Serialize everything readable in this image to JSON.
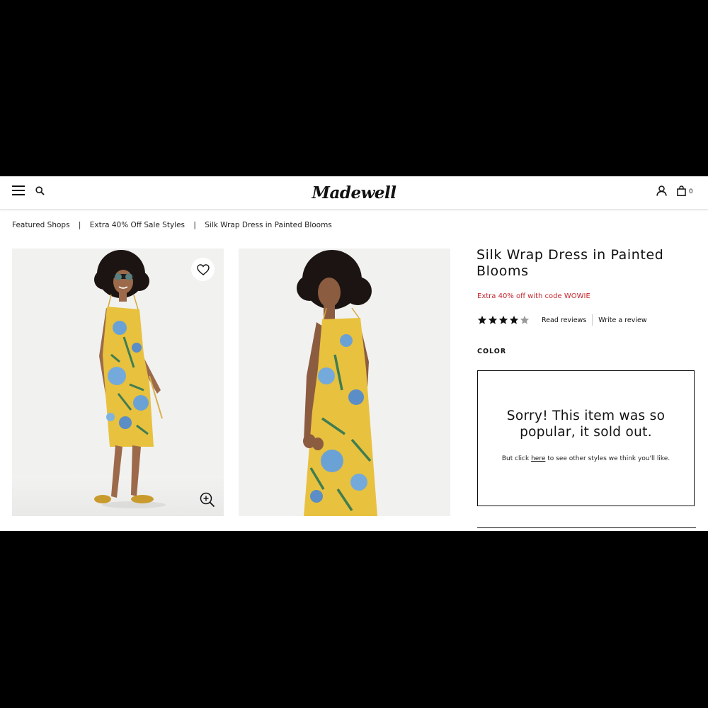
{
  "header": {
    "logo": "Madewell",
    "bag_count": "0"
  },
  "breadcrumb": [
    {
      "label": "Featured Shops"
    },
    {
      "label": "Extra 40% Off Sale Styles"
    },
    {
      "label": "Silk Wrap Dress in Painted Blooms"
    }
  ],
  "breadcrumb_separator": "|",
  "product": {
    "title": "Silk Wrap Dress in Painted Blooms",
    "promo": "Extra 40% off with code WOWIE",
    "rating": 4,
    "rating_max": 5,
    "read_reviews_label": "Read reviews",
    "write_review_label": "Write a review",
    "color_label": "COLOR"
  },
  "soldout": {
    "heading": "Sorry! This item was so popular, it sold out.",
    "sub_before": "But click ",
    "sub_link": "here",
    "sub_after": " to see other styles we think you'll like."
  },
  "icons": {
    "menu": "hamburger-icon",
    "search": "search-icon",
    "account": "user-icon",
    "bag": "shopping-bag-icon",
    "wishlist": "heart-icon",
    "zoom": "zoom-in-icon",
    "rating": "star-icon"
  },
  "colors": {
    "promo": "#c4262e",
    "star_filled": "#111111",
    "star_empty": "#9a9a9a",
    "dress": "#e8c13e"
  }
}
